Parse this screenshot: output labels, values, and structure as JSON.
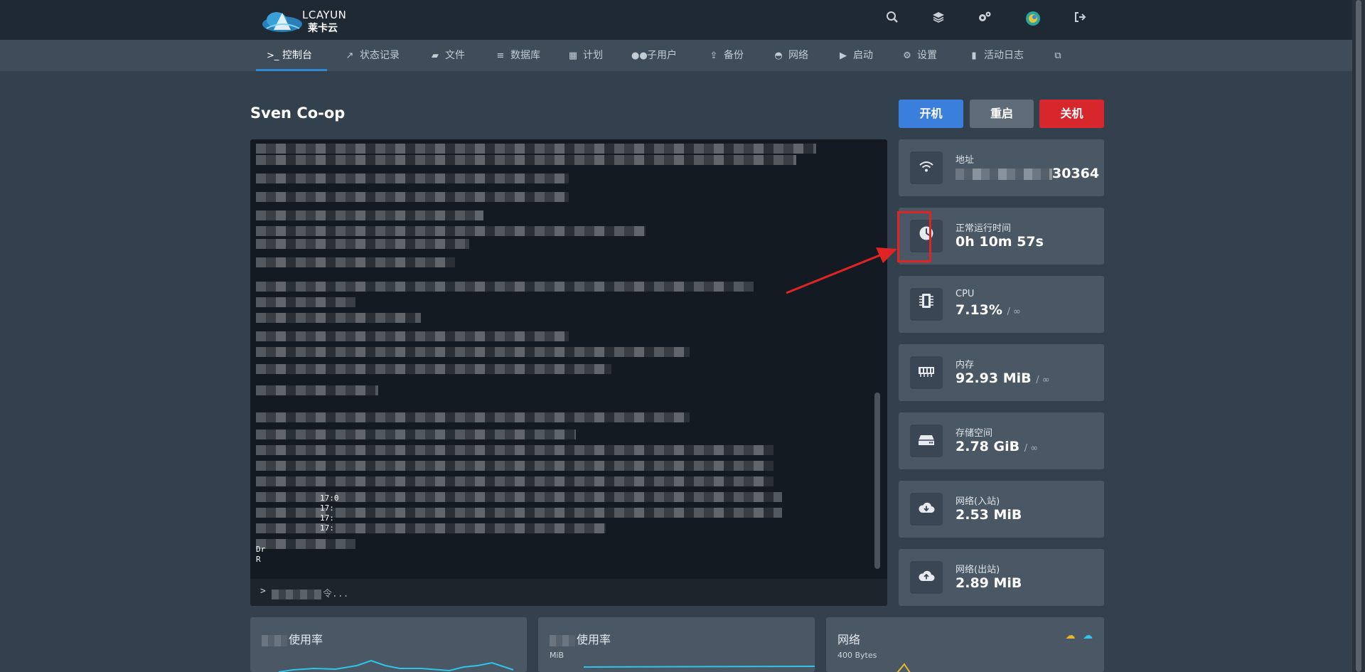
{
  "brand": {
    "logo_text": "LCAYUN",
    "logo_sub": "莱卡云"
  },
  "header_icons": [
    "search-icon",
    "layers-icon",
    "cogs-icon",
    "avatar",
    "logout-icon"
  ],
  "nav": {
    "items": [
      {
        "label": "控制台",
        "icon": "terminal-icon",
        "active": true
      },
      {
        "label": "状态记录",
        "icon": "chart-line-icon"
      },
      {
        "label": "文件",
        "icon": "folder-icon"
      },
      {
        "label": "数据库",
        "icon": "database-icon"
      },
      {
        "label": "计划",
        "icon": "calendar-icon"
      },
      {
        "label": "子用户",
        "icon": "users-icon"
      },
      {
        "label": "备份",
        "icon": "upload-icon"
      },
      {
        "label": "网络",
        "icon": "network-icon"
      },
      {
        "label": "启动",
        "icon": "play-icon"
      },
      {
        "label": "设置",
        "icon": "cogs-icon"
      },
      {
        "label": "活动日志",
        "icon": "book-icon"
      }
    ]
  },
  "server": {
    "name": "Sven Co-op"
  },
  "power": {
    "start": "开机",
    "restart": "重启",
    "stop": "关机"
  },
  "console": {
    "prompt": ">",
    "placeholder_suffix": "令...",
    "visible_fragments": [
      "17:0",
      "17:",
      "17:",
      "17:",
      "Dr",
      "R"
    ]
  },
  "stats": [
    {
      "label": "地址",
      "value": "30364",
      "icon": "wifi-icon"
    },
    {
      "label": "正常运行时间",
      "value": "0h 10m 57s",
      "icon": "clock-icon"
    },
    {
      "label": "CPU",
      "value": "7.13%",
      "limit": "/ ∞",
      "icon": "microchip-icon"
    },
    {
      "label": "内存",
      "value": "92.93 MiB",
      "limit": "/ ∞",
      "icon": "memory-icon"
    },
    {
      "label": "存储空间",
      "value": "2.78 GiB",
      "limit": "/ ∞",
      "icon": "hdd-icon"
    },
    {
      "label": "网络(入站)",
      "value": "2.53 MiB",
      "icon": "cloud-download-icon"
    },
    {
      "label": "网络(出站)",
      "value": "2.89 MiB",
      "icon": "cloud-upload-icon"
    }
  ],
  "charts": [
    {
      "title_suffix": "使用率"
    },
    {
      "title_suffix": "使用率",
      "ylabel": "MiB"
    },
    {
      "title": "网络",
      "ylabel": "400 Bytes"
    }
  ],
  "colors": {
    "accent": "#2f8ad3",
    "start": "#3b7fdc",
    "restart": "#5e6b78",
    "stop": "#d8262d",
    "annotation": "#e02424",
    "chart_line": "#2fc4e8"
  }
}
